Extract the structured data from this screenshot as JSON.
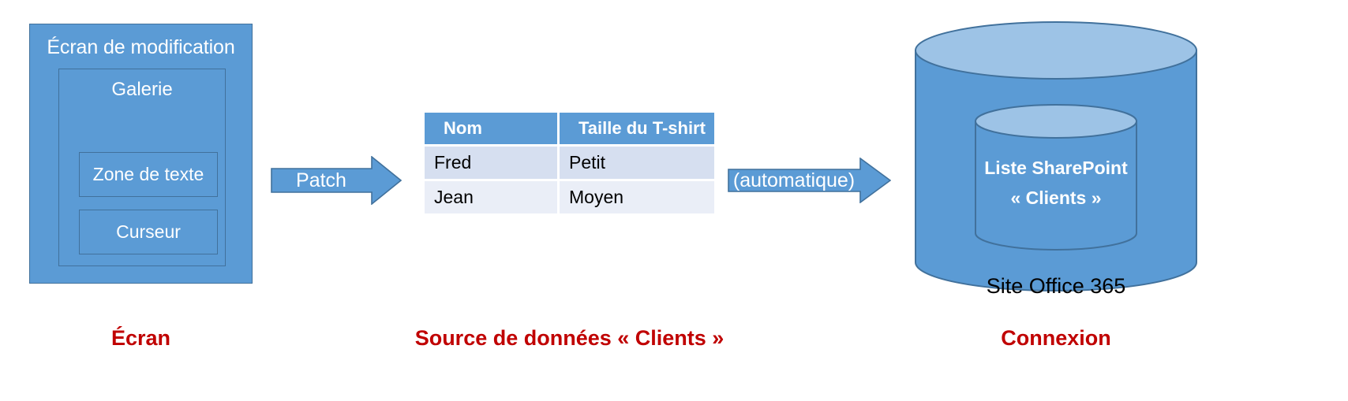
{
  "screen": {
    "title": "Écran de modification",
    "gallery": {
      "title": "Galerie",
      "textbox_label": "Zone de texte",
      "cursor_label": "Curseur"
    },
    "caption": "Écran"
  },
  "arrows": {
    "patch": {
      "label": "Patch"
    },
    "automatic": {
      "label": "(automatique)"
    }
  },
  "data_source": {
    "columns": [
      "Nom",
      "Taille du T-shirt"
    ],
    "rows": [
      {
        "nom": "Fred",
        "taille": "Petit"
      },
      {
        "nom": "Jean",
        "taille": "Moyen"
      }
    ],
    "caption": "Source de données « Clients »"
  },
  "connection": {
    "cylinder_line1": "Liste SharePoint",
    "cylinder_line2": "« Clients »",
    "site_label": "Site Office 365",
    "caption": "Connexion"
  },
  "colors": {
    "accent_blue": "#5B9BD5",
    "accent_blue_dark": "#41719C",
    "cylinder_top": "#9DC3E6",
    "table_row_odd": "#D6DFF0",
    "table_row_even": "#EAEEF7",
    "caption_red": "#C00000",
    "background": "#FFFFFF"
  }
}
